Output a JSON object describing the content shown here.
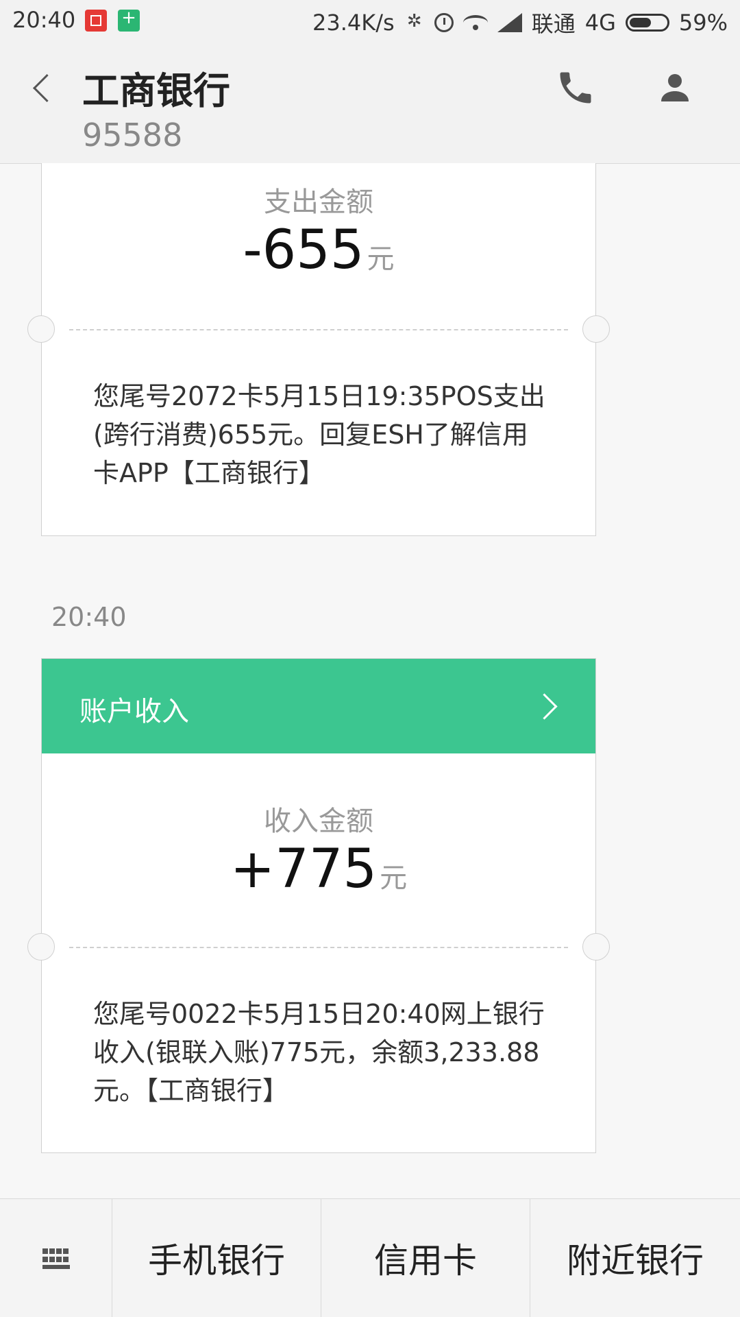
{
  "status_bar": {
    "time": "20:40",
    "net_speed": "23.4K/s",
    "carrier": "联通",
    "network": "4G",
    "battery": "59%",
    "icons": [
      "bluetooth-icon",
      "alarm-icon",
      "wifi-icon",
      "signal-icon",
      "battery-icon"
    ]
  },
  "header": {
    "title": "工商银行",
    "number": "95588",
    "icons": [
      "back-icon",
      "phone-icon",
      "contact-icon"
    ]
  },
  "messages": [
    {
      "amount_label": "支出金额",
      "amount": "-655",
      "unit": "元",
      "text": "您尾号2072卡5月15日19:35POS支出(跨行消费)655元。回复ESH了解信用卡APP【工商银行】"
    },
    {
      "time": "20:40",
      "banner_title": "账户收入",
      "amount_label": "收入金额",
      "amount": "+775",
      "unit": "元",
      "text": "您尾号0022卡5月15日20:40网上银行收入(银联入账)775元，余额3,233.88元。【工商银行】"
    }
  ],
  "bottom_menu": {
    "items": [
      "手机银行",
      "信用卡",
      "附近银行"
    ]
  },
  "colors": {
    "accent": "#3cc690"
  }
}
